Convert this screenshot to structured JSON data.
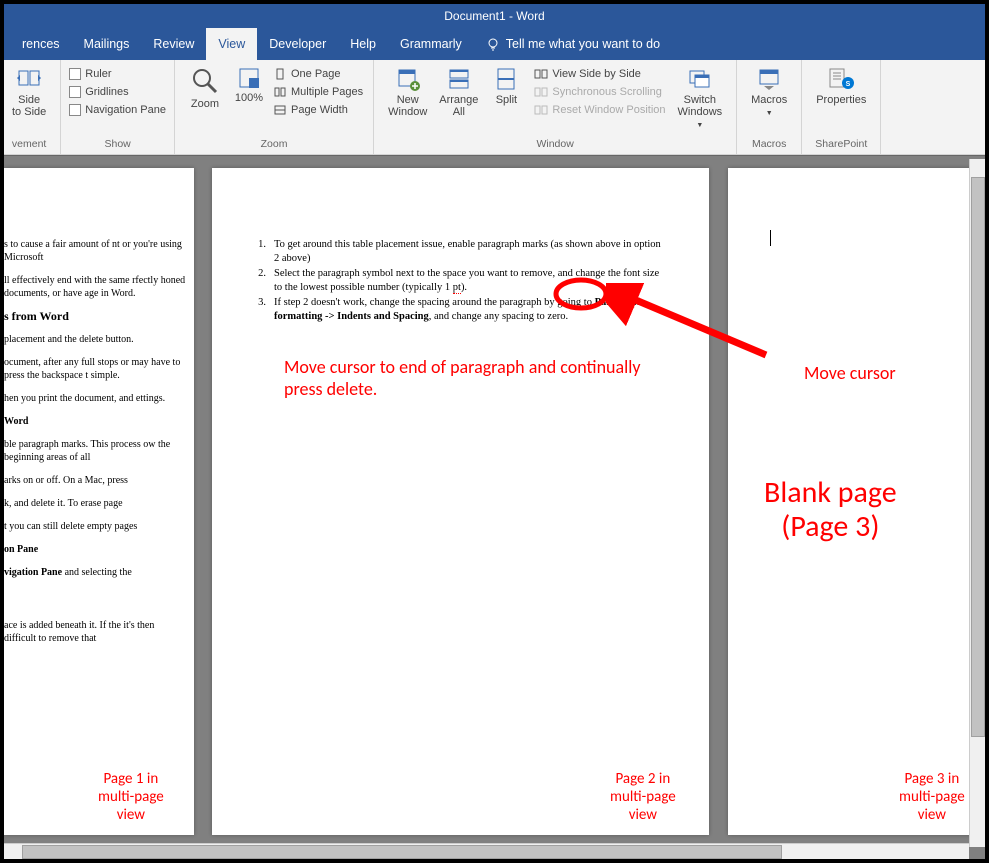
{
  "title": "Document1  -  Word",
  "tabs": {
    "references": "rences",
    "mailings": "Mailings",
    "review": "Review",
    "view": "View",
    "developer": "Developer",
    "help": "Help",
    "grammarly": "Grammarly",
    "tell_me": "Tell me what you want to do"
  },
  "ribbon": {
    "views_group": {
      "side_to_side": "Side\nto Side",
      "label": "vement"
    },
    "show_group": {
      "ruler": "Ruler",
      "gridlines": "Gridlines",
      "nav_pane": "Navigation Pane",
      "label": "Show"
    },
    "zoom_group": {
      "zoom": "Zoom",
      "hundred": "100%",
      "one_page": "One Page",
      "multiple_pages": "Multiple Pages",
      "page_width": "Page Width",
      "label": "Zoom"
    },
    "window_group": {
      "new_window": "New\nWindow",
      "arrange_all": "Arrange\nAll",
      "split": "Split",
      "side_by_side": "View Side by Side",
      "sync_scroll": "Synchronous Scrolling",
      "reset_pos": "Reset Window Position",
      "switch_windows": "Switch\nWindows",
      "label": "Window"
    },
    "macros_group": {
      "macros": "Macros",
      "label": "Macros"
    },
    "sharepoint_group": {
      "properties": "Properties",
      "label": "SharePoint"
    }
  },
  "page1": {
    "p1": "s to cause a fair amount of nt or you're using Microsoft",
    "p2": "ll effectively end with the same rfectly honed documents, or have age in Word.",
    "h1": "s from Word",
    "p3": "placement and the delete button.",
    "p4": "ocument, after any full stops or may have to press the backspace t simple.",
    "p5": "hen you print the document, and ettings.",
    "h2": "Word",
    "p6": "ble paragraph marks. This process ow the beginning areas of all",
    "p7": "arks on or off. On a Mac, press",
    "p8": "k, and delete it. To erase page",
    "p9": "t you can still delete empty pages",
    "h3": "on Pane",
    "p10": "vigation Pane and selecting the",
    "p11": "ace is added beneath it. If the it's then difficult to remove that"
  },
  "page2": {
    "l1": "To get around this table placement issue, enable paragraph marks (as shown above in option 2 above)",
    "l2a": "Select the paragraph symbol next to the space you want to remove, and change the font size to the lowest possible number (typically 1 ",
    "l2b": "pt",
    "l2c": ").",
    "l3a": "If step 2 doesn't work, change the spacing around the paragraph by going to ",
    "l3b": "Paragraph formatting -> Indents and Spacing",
    "l3c": ", and change any spacing to zero."
  },
  "annotations": {
    "instruct": "Move cursor to end of paragraph and continually press delete.",
    "move_cursor": "Move cursor",
    "blank_page": "Blank page\n(Page 3)",
    "p1_label": "Page 1 in\nmulti-page\nview",
    "p2_label": "Page 2 in\nmulti-page\nview",
    "p3_label": "Page 3 in\nmulti-page\nview"
  }
}
